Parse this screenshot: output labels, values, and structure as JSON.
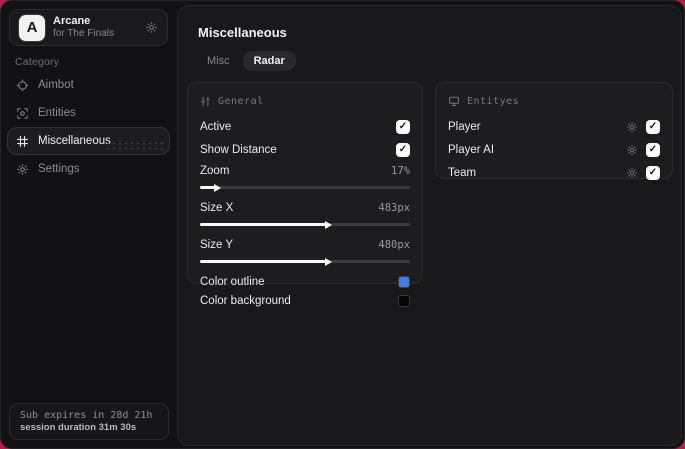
{
  "sidebar": {
    "logo": {
      "letter": "A",
      "title": "Arcane",
      "subtitle": "for The Finals"
    },
    "category_label": "Category",
    "items": [
      {
        "label": "Aimbot"
      },
      {
        "label": "Entities"
      },
      {
        "label": "Miscellaneous"
      },
      {
        "label": "Settings"
      }
    ],
    "footer": {
      "line1": "Sub expires in 28d 21h",
      "line2": "session duration 31m 30s"
    }
  },
  "main": {
    "title": "Miscellaneous",
    "tabs": [
      {
        "label": "Misc"
      },
      {
        "label": "Radar"
      }
    ],
    "general_panel": {
      "header": "General",
      "rows": {
        "active": {
          "label": "Active",
          "checked": true
        },
        "show_distance": {
          "label": "Show Distance",
          "checked": true
        },
        "zoom": {
          "label": "Zoom",
          "value": "17%",
          "fill_pct": 7
        },
        "size_x": {
          "label": "Size X",
          "value": "483px",
          "fill_pct": 60
        },
        "size_y": {
          "label": "Size Y",
          "value": "480px",
          "fill_pct": 60
        },
        "color_outline": {
          "label": "Color outline",
          "color": "#3f7ee0"
        },
        "color_background": {
          "label": "Color background",
          "color": "#050505"
        }
      }
    },
    "entities_panel": {
      "header": "Entityes",
      "rows": [
        {
          "label": "Player",
          "checked": true
        },
        {
          "label": "Player AI",
          "checked": true
        },
        {
          "label": "Team",
          "checked": true
        }
      ]
    }
  },
  "icons": {
    "check": "✓"
  },
  "colors": {
    "accent_blue": "#3f7ee0",
    "corner_glow": "#b42045"
  }
}
